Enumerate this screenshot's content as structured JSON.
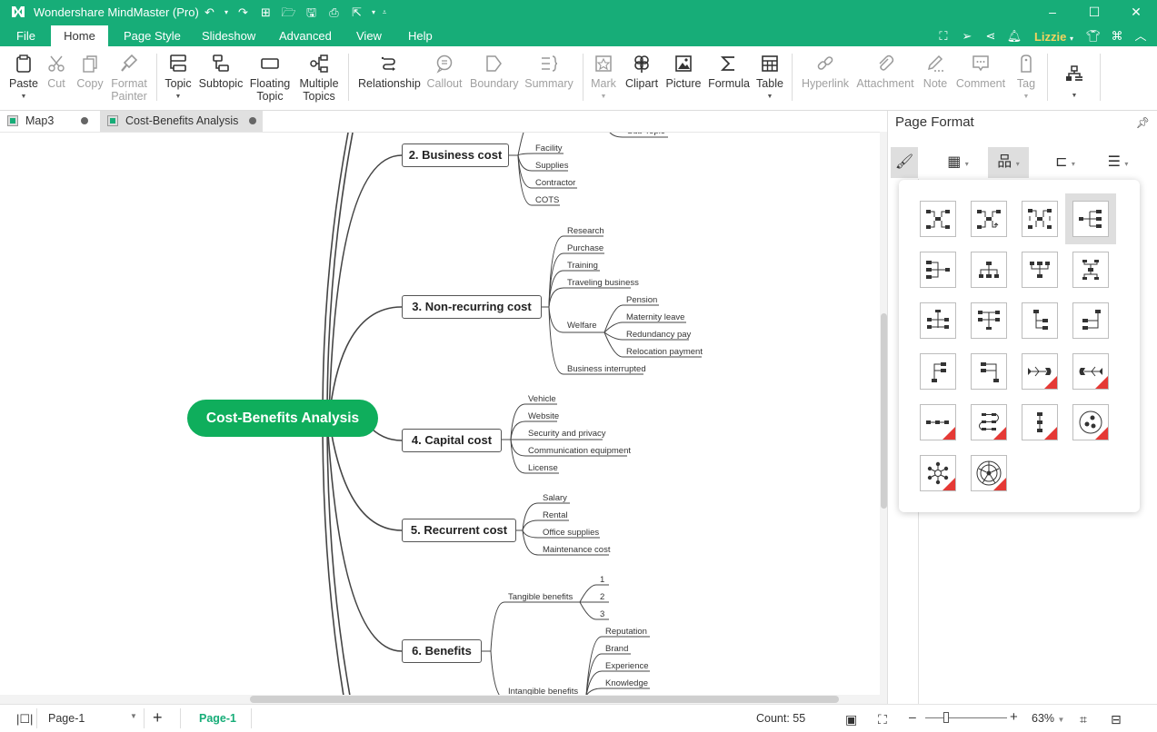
{
  "app": {
    "title": "Wondershare MindMaster (Pro)",
    "window_controls": [
      "minimize",
      "maximize",
      "close"
    ]
  },
  "quick_access": [
    "undo-icon",
    "redo-icon",
    "new-icon",
    "open-icon",
    "save-icon",
    "print-icon",
    "export-icon",
    "customize-icon"
  ],
  "menu": {
    "tabs": [
      "File",
      "Home",
      "Page Style",
      "Slideshow",
      "Advanced",
      "View",
      "Help"
    ],
    "active": "Home",
    "user": "Lizzie",
    "right_icons": [
      "fullscreen-icon",
      "publish-icon",
      "share-icon",
      "notification-icon",
      "theme-icon",
      "apps-icon",
      "collapse-ribbon-icon"
    ]
  },
  "ribbon": {
    "groups": [
      {
        "buttons": [
          {
            "label": "Paste",
            "icon": "paste-icon",
            "enabled": true,
            "dropdown": true
          },
          {
            "label": "Cut",
            "icon": "cut-icon",
            "enabled": false
          },
          {
            "label": "Copy",
            "icon": "copy-icon",
            "enabled": false
          },
          {
            "label": "Format Painter",
            "line1": "Format",
            "line2": "Painter",
            "icon": "format-painter-icon",
            "enabled": false
          }
        ]
      },
      {
        "buttons": [
          {
            "label": "Topic",
            "icon": "topic-icon",
            "enabled": true,
            "dropdown": true
          },
          {
            "label": "Subtopic",
            "icon": "subtopic-icon",
            "enabled": true
          },
          {
            "label": "Floating Topic",
            "line1": "Floating",
            "line2": "Topic",
            "icon": "floating-topic-icon",
            "enabled": true
          },
          {
            "label": "Multiple Topics",
            "line1": "Multiple",
            "line2": "Topics",
            "icon": "multiple-topics-icon",
            "enabled": true
          }
        ]
      },
      {
        "buttons": [
          {
            "label": "Relationship",
            "icon": "relationship-icon",
            "enabled": true
          },
          {
            "label": "Callout",
            "icon": "callout-icon",
            "enabled": false
          },
          {
            "label": "Boundary",
            "icon": "boundary-icon",
            "enabled": false
          },
          {
            "label": "Summary",
            "icon": "summary-icon",
            "enabled": false
          }
        ]
      },
      {
        "buttons": [
          {
            "label": "Mark",
            "icon": "mark-icon",
            "enabled": false,
            "dropdown": true
          },
          {
            "label": "Clipart",
            "icon": "clipart-icon",
            "enabled": true
          },
          {
            "label": "Picture",
            "icon": "picture-icon",
            "enabled": true
          },
          {
            "label": "Formula",
            "icon": "formula-icon",
            "enabled": true
          },
          {
            "label": "Table",
            "icon": "table-icon",
            "enabled": true,
            "dropdown": true
          }
        ]
      },
      {
        "buttons": [
          {
            "label": "Hyperlink",
            "icon": "hyperlink-icon",
            "enabled": false
          },
          {
            "label": "Attachment",
            "icon": "attachment-icon",
            "enabled": false
          },
          {
            "label": "Note",
            "icon": "note-icon",
            "enabled": false
          },
          {
            "label": "Comment",
            "icon": "comment-icon",
            "enabled": false
          },
          {
            "label": "Tag",
            "icon": "tag-icon",
            "enabled": false,
            "dropdown": true
          }
        ]
      },
      {
        "buttons": [
          {
            "label": "",
            "icon": "layout-icon",
            "enabled": true,
            "dropdown": true
          }
        ]
      }
    ]
  },
  "doc_tabs": [
    {
      "label": "Map3",
      "active": false
    },
    {
      "label": "Cost-Benefits Analysis",
      "active": true
    }
  ],
  "mindmap": {
    "central": "Cost-Benefits Analysis",
    "topics": [
      {
        "label": "2. Business cost",
        "subtopics": [
          "Sub Topic",
          "Facility",
          "Supplies",
          "Contractor",
          "COTS"
        ]
      },
      {
        "label": "3. Non-recurring cost",
        "subtopics": [
          "Research",
          "Purchase",
          "Training",
          "Traveling business",
          "Welfare",
          "Business interrupted"
        ],
        "welfare_children": [
          "Pension",
          "Maternity leave",
          "Redundancy pay",
          "Relocation payment"
        ]
      },
      {
        "label": "4. Capital cost",
        "subtopics": [
          "Vehicle",
          "Website",
          "Security and privacy",
          "Communication equipment",
          "License"
        ]
      },
      {
        "label": "5. Recurrent cost",
        "subtopics": [
          "Salary",
          "Rental",
          "Office supplies",
          "Maintenance cost"
        ]
      },
      {
        "label": "6. Benefits",
        "subtopics": [
          "Tangible benefits",
          "Intangible benefits"
        ],
        "tangible_children": [
          "1",
          "2",
          "3"
        ],
        "intangible_children": [
          "Reputation",
          "Brand",
          "Experience",
          "Knowledge"
        ]
      }
    ],
    "colors": {
      "central": "#0fae5c",
      "accent": "#17ad78"
    }
  },
  "pane": {
    "title": "Page Format",
    "tools": [
      "format-painter-icon",
      "theme-grid-icon",
      "layout-icon",
      "connector-icon",
      "numbering-icon"
    ],
    "selected_tool": "layout-icon",
    "layouts": [
      {
        "name": "mind-map",
        "pro": false
      },
      {
        "name": "mind-map-clockwise",
        "pro": false
      },
      {
        "name": "mind-map-anticlockwise",
        "pro": false
      },
      {
        "name": "right-map",
        "pro": false,
        "selected": true
      },
      {
        "name": "left-map",
        "pro": false
      },
      {
        "name": "org-chart-down",
        "pro": false
      },
      {
        "name": "org-chart-up",
        "pro": false
      },
      {
        "name": "org-chart-both",
        "pro": false
      },
      {
        "name": "tree-both",
        "pro": false
      },
      {
        "name": "tree-up-both",
        "pro": false
      },
      {
        "name": "tree-right",
        "pro": false
      },
      {
        "name": "tree-left",
        "pro": false
      },
      {
        "name": "tree-right-up",
        "pro": false
      },
      {
        "name": "tree-left-up",
        "pro": false
      },
      {
        "name": "fishbone-right",
        "pro": true
      },
      {
        "name": "fishbone-left",
        "pro": true
      },
      {
        "name": "timeline-horizontal",
        "pro": true
      },
      {
        "name": "timeline-winding",
        "pro": true
      },
      {
        "name": "timeline-vertical",
        "pro": true
      },
      {
        "name": "circle-map",
        "pro": true
      },
      {
        "name": "bubble-map",
        "pro": true
      },
      {
        "name": "sector-map",
        "pro": true
      }
    ]
  },
  "status": {
    "page_select": "Page-1",
    "page_tab": "Page-1",
    "count": "Count: 55",
    "zoom": "63%",
    "zoom_fraction": 0.25
  }
}
